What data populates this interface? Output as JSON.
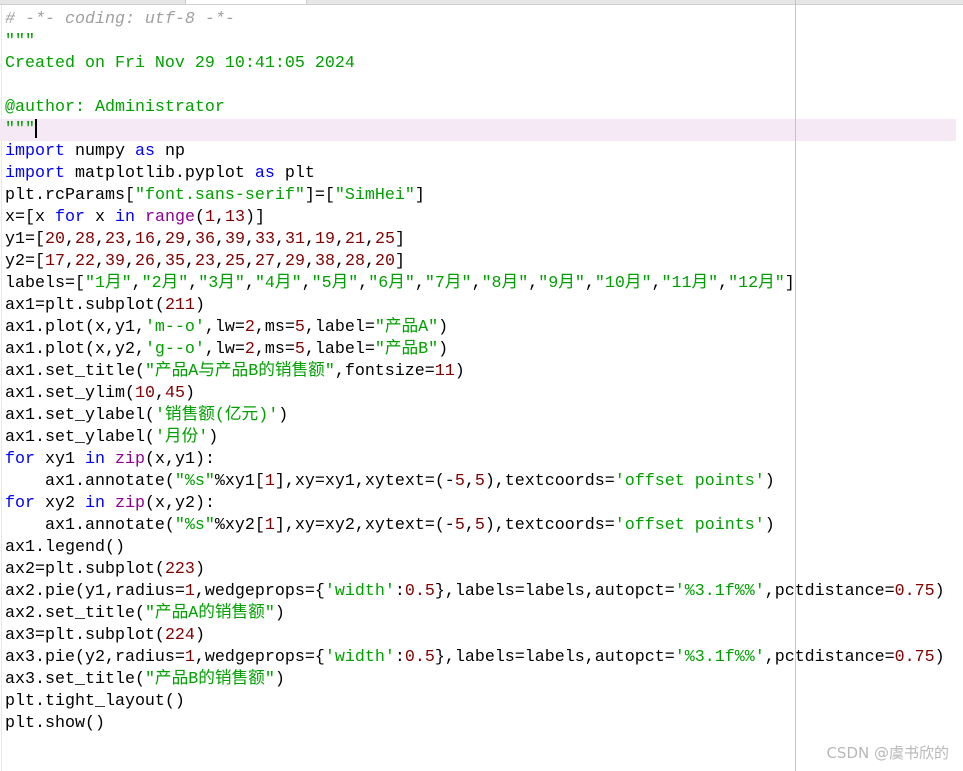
{
  "editor": {
    "current_line": 5,
    "colors": {
      "comment": "#a0a0a0",
      "string": "#00a000",
      "keyword": "#0000ff",
      "number": "#800000",
      "builtin": "#900090",
      "current_line_bg": "#f5e9f5"
    },
    "lines": [
      [
        [
          "c",
          "# -*- coding: utf-8 -*-"
        ]
      ],
      [
        [
          "s",
          "\"\"\""
        ]
      ],
      [
        [
          "s",
          "Created on Fri Nov 29 10:41:05 2024"
        ]
      ],
      [],
      [
        [
          "s",
          "@author: Administrator"
        ]
      ],
      [
        [
          "s",
          "\"\"\""
        ]
      ],
      [
        [
          "k",
          "import"
        ],
        [
          "t",
          " numpy "
        ],
        [
          "k",
          "as"
        ],
        [
          "t",
          " np"
        ]
      ],
      [
        [
          "k",
          "import"
        ],
        [
          "t",
          " matplotlib.pyplot "
        ],
        [
          "k",
          "as"
        ],
        [
          "t",
          " plt"
        ]
      ],
      [
        [
          "t",
          "plt.rcParams["
        ],
        [
          "s",
          "\"font.sans-serif\""
        ],
        [
          "t",
          "]=["
        ],
        [
          "s",
          "\"SimHei\""
        ],
        [
          "t",
          "]"
        ]
      ],
      [
        [
          "t",
          "x=[x "
        ],
        [
          "k",
          "for"
        ],
        [
          "t",
          " x "
        ],
        [
          "k",
          "in"
        ],
        [
          "t",
          " "
        ],
        [
          "b",
          "range"
        ],
        [
          "t",
          "("
        ],
        [
          "n",
          "1"
        ],
        [
          "t",
          ","
        ],
        [
          "n",
          "13"
        ],
        [
          "t",
          ")]"
        ]
      ],
      [
        [
          "t",
          "y1=["
        ],
        [
          "n",
          "20"
        ],
        [
          "t",
          ","
        ],
        [
          "n",
          "28"
        ],
        [
          "t",
          ","
        ],
        [
          "n",
          "23"
        ],
        [
          "t",
          ","
        ],
        [
          "n",
          "16"
        ],
        [
          "t",
          ","
        ],
        [
          "n",
          "29"
        ],
        [
          "t",
          ","
        ],
        [
          "n",
          "36"
        ],
        [
          "t",
          ","
        ],
        [
          "n",
          "39"
        ],
        [
          "t",
          ","
        ],
        [
          "n",
          "33"
        ],
        [
          "t",
          ","
        ],
        [
          "n",
          "31"
        ],
        [
          "t",
          ","
        ],
        [
          "n",
          "19"
        ],
        [
          "t",
          ","
        ],
        [
          "n",
          "21"
        ],
        [
          "t",
          ","
        ],
        [
          "n",
          "25"
        ],
        [
          "t",
          "]"
        ]
      ],
      [
        [
          "t",
          "y2=["
        ],
        [
          "n",
          "17"
        ],
        [
          "t",
          ","
        ],
        [
          "n",
          "22"
        ],
        [
          "t",
          ","
        ],
        [
          "n",
          "39"
        ],
        [
          "t",
          ","
        ],
        [
          "n",
          "26"
        ],
        [
          "t",
          ","
        ],
        [
          "n",
          "35"
        ],
        [
          "t",
          ","
        ],
        [
          "n",
          "23"
        ],
        [
          "t",
          ","
        ],
        [
          "n",
          "25"
        ],
        [
          "t",
          ","
        ],
        [
          "n",
          "27"
        ],
        [
          "t",
          ","
        ],
        [
          "n",
          "29"
        ],
        [
          "t",
          ","
        ],
        [
          "n",
          "38"
        ],
        [
          "t",
          ","
        ],
        [
          "n",
          "28"
        ],
        [
          "t",
          ","
        ],
        [
          "n",
          "20"
        ],
        [
          "t",
          "]"
        ]
      ],
      [
        [
          "t",
          "labels=["
        ],
        [
          "s",
          "\"1月\""
        ],
        [
          "t",
          ","
        ],
        [
          "s",
          "\"2月\""
        ],
        [
          "t",
          ","
        ],
        [
          "s",
          "\"3月\""
        ],
        [
          "t",
          ","
        ],
        [
          "s",
          "\"4月\""
        ],
        [
          "t",
          ","
        ],
        [
          "s",
          "\"5月\""
        ],
        [
          "t",
          ","
        ],
        [
          "s",
          "\"6月\""
        ],
        [
          "t",
          ","
        ],
        [
          "s",
          "\"7月\""
        ],
        [
          "t",
          ","
        ],
        [
          "s",
          "\"8月\""
        ],
        [
          "t",
          ","
        ],
        [
          "s",
          "\"9月\""
        ],
        [
          "t",
          ","
        ],
        [
          "s",
          "\"10月\""
        ],
        [
          "t",
          ","
        ],
        [
          "s",
          "\"11月\""
        ],
        [
          "t",
          ","
        ],
        [
          "s",
          "\"12月\""
        ],
        [
          "t",
          "]"
        ]
      ],
      [
        [
          "t",
          "ax1=plt.subplot("
        ],
        [
          "n",
          "211"
        ],
        [
          "t",
          ")"
        ]
      ],
      [
        [
          "t",
          "ax1.plot(x,y1,"
        ],
        [
          "s",
          "'m--o'"
        ],
        [
          "t",
          ",lw="
        ],
        [
          "n",
          "2"
        ],
        [
          "t",
          ",ms="
        ],
        [
          "n",
          "5"
        ],
        [
          "t",
          ",label="
        ],
        [
          "s",
          "\"产品A\""
        ],
        [
          "t",
          ")"
        ]
      ],
      [
        [
          "t",
          "ax1.plot(x,y2,"
        ],
        [
          "s",
          "'g--o'"
        ],
        [
          "t",
          ",lw="
        ],
        [
          "n",
          "2"
        ],
        [
          "t",
          ",ms="
        ],
        [
          "n",
          "5"
        ],
        [
          "t",
          ",label="
        ],
        [
          "s",
          "\"产品B\""
        ],
        [
          "t",
          ")"
        ]
      ],
      [
        [
          "t",
          "ax1.set_title("
        ],
        [
          "s",
          "\"产品A与产品B的销售额\""
        ],
        [
          "t",
          ",fontsize="
        ],
        [
          "n",
          "11"
        ],
        [
          "t",
          ")"
        ]
      ],
      [
        [
          "t",
          "ax1.set_ylim("
        ],
        [
          "n",
          "10"
        ],
        [
          "t",
          ","
        ],
        [
          "n",
          "45"
        ],
        [
          "t",
          ")"
        ]
      ],
      [
        [
          "t",
          "ax1.set_ylabel("
        ],
        [
          "s",
          "'销售额(亿元)'"
        ],
        [
          "t",
          ")"
        ]
      ],
      [
        [
          "t",
          "ax1.set_ylabel("
        ],
        [
          "s",
          "'月份'"
        ],
        [
          "t",
          ")"
        ]
      ],
      [
        [
          "k",
          "for"
        ],
        [
          "t",
          " xy1 "
        ],
        [
          "k",
          "in"
        ],
        [
          "t",
          " "
        ],
        [
          "b",
          "zip"
        ],
        [
          "t",
          "(x,y1):"
        ]
      ],
      [
        [
          "t",
          "    ax1.annotate("
        ],
        [
          "s",
          "\"%s\""
        ],
        [
          "t",
          "%xy1["
        ],
        [
          "n",
          "1"
        ],
        [
          "t",
          "],xy=xy1,xytext=(-"
        ],
        [
          "n",
          "5"
        ],
        [
          "t",
          ","
        ],
        [
          "n",
          "5"
        ],
        [
          "t",
          "),textcoords="
        ],
        [
          "s",
          "'offset points'"
        ],
        [
          "t",
          ")"
        ]
      ],
      [
        [
          "k",
          "for"
        ],
        [
          "t",
          " xy2 "
        ],
        [
          "k",
          "in"
        ],
        [
          "t",
          " "
        ],
        [
          "b",
          "zip"
        ],
        [
          "t",
          "(x,y2):"
        ]
      ],
      [
        [
          "t",
          "    ax1.annotate("
        ],
        [
          "s",
          "\"%s\""
        ],
        [
          "t",
          "%xy2["
        ],
        [
          "n",
          "1"
        ],
        [
          "t",
          "],xy=xy2,xytext=(-"
        ],
        [
          "n",
          "5"
        ],
        [
          "t",
          ","
        ],
        [
          "n",
          "5"
        ],
        [
          "t",
          "),textcoords="
        ],
        [
          "s",
          "'offset points'"
        ],
        [
          "t",
          ")"
        ]
      ],
      [
        [
          "t",
          "ax1.legend()"
        ]
      ],
      [
        [
          "t",
          "ax2=plt.subplot("
        ],
        [
          "n",
          "223"
        ],
        [
          "t",
          ")"
        ]
      ],
      [
        [
          "t",
          "ax2.pie(y1,radius="
        ],
        [
          "n",
          "1"
        ],
        [
          "t",
          ",wedgeprops={"
        ],
        [
          "s",
          "'width'"
        ],
        [
          "t",
          ":"
        ],
        [
          "n",
          "0.5"
        ],
        [
          "t",
          "},labels=labels,autopct="
        ],
        [
          "s",
          "'%3.1f%%'"
        ],
        [
          "t",
          ",pctdistance="
        ],
        [
          "n",
          "0.75"
        ],
        [
          "t",
          ")"
        ]
      ],
      [
        [
          "t",
          "ax2.set_title("
        ],
        [
          "s",
          "\"产品A的销售额\""
        ],
        [
          "t",
          ")"
        ]
      ],
      [
        [
          "t",
          "ax3=plt.subplot("
        ],
        [
          "n",
          "224"
        ],
        [
          "t",
          ")"
        ]
      ],
      [
        [
          "t",
          "ax3.pie(y2,radius="
        ],
        [
          "n",
          "1"
        ],
        [
          "t",
          ",wedgeprops={"
        ],
        [
          "s",
          "'width'"
        ],
        [
          "t",
          ":"
        ],
        [
          "n",
          "0.5"
        ],
        [
          "t",
          "},labels=labels,autopct="
        ],
        [
          "s",
          "'%3.1f%%'"
        ],
        [
          "t",
          ",pctdistance="
        ],
        [
          "n",
          "0.75"
        ],
        [
          "t",
          ")"
        ]
      ],
      [
        [
          "t",
          "ax3.set_title("
        ],
        [
          "s",
          "\"产品B的销售额\""
        ],
        [
          "t",
          ")"
        ]
      ],
      [
        [
          "t",
          "plt.tight_layout()"
        ]
      ],
      [
        [
          "t",
          "plt.show()"
        ]
      ]
    ]
  },
  "watermark": "CSDN @虞书欣的"
}
